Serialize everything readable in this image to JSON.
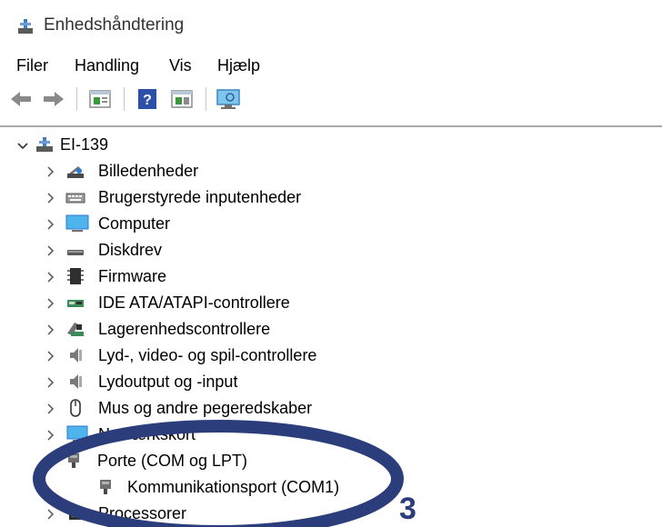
{
  "window": {
    "title": "Enhedshåndtering",
    "icon": "device-manager-icon"
  },
  "menu": [
    "Filer",
    "Handling",
    "Vis",
    "Hjælp"
  ],
  "toolbar": {
    "buttons": [
      "back-arrow-icon",
      "forward-arrow-icon",
      "properties-icon",
      "help-icon",
      "view-icon",
      "scan-hardware-icon"
    ]
  },
  "tree": {
    "root": {
      "label": "EI-139",
      "expanded": true
    },
    "items": [
      {
        "label": "Billedenheder",
        "icon": "camera-icon"
      },
      {
        "label": "Brugerstyrede inputenheder",
        "icon": "keyboard-icon"
      },
      {
        "label": "Computer",
        "icon": "monitor-icon"
      },
      {
        "label": "Diskdrev",
        "icon": "disk-icon"
      },
      {
        "label": "Firmware",
        "icon": "chip-icon"
      },
      {
        "label": "IDE ATA/ATAPI-controllere",
        "icon": "ide-controller-icon"
      },
      {
        "label": "Lagerenhedscontrollere",
        "icon": "storage-controller-icon"
      },
      {
        "label": "Lyd-, video- og spil-controllere",
        "icon": "speaker-icon"
      },
      {
        "label": "Lydoutput og -input",
        "icon": "speaker-icon"
      },
      {
        "label": "Mus og andre pegeredskaber",
        "icon": "mouse-icon"
      },
      {
        "label": "Netværkskort",
        "icon": "network-icon"
      },
      {
        "label": "Porte (COM og LPT)",
        "icon": "port-icon",
        "expanded": true
      },
      {
        "label": "Kommunikationsport (COM1)",
        "icon": "port-icon",
        "child": true
      },
      {
        "label": "Processorer",
        "icon": "processor-icon"
      }
    ]
  },
  "annotation": {
    "number": "3",
    "color": "#2b3d7a"
  }
}
